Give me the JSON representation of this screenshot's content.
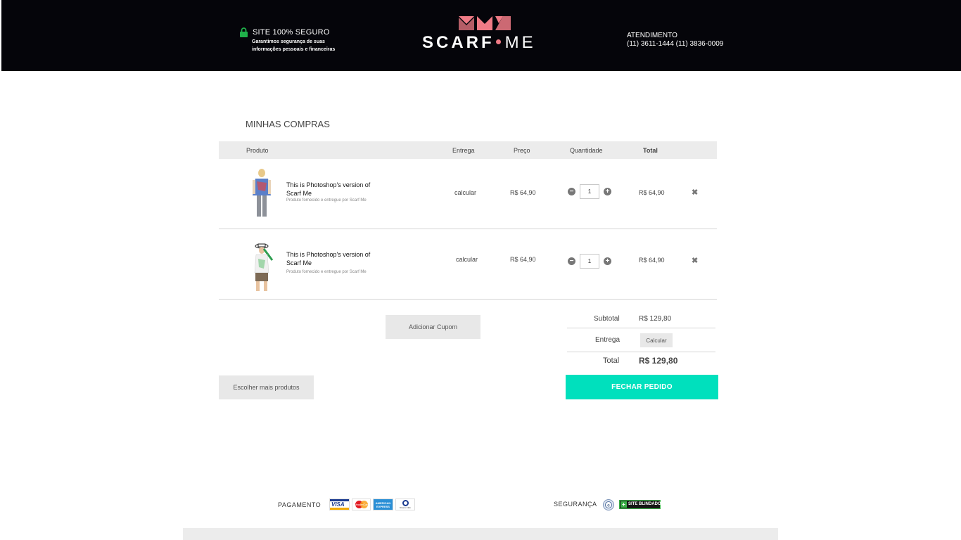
{
  "header": {
    "secure_title": "SITE 100% SEGURO",
    "secure_sub": "Garantimos segurança de suas informações pessoais e financeiras",
    "logo_left": "SCARF",
    "logo_right": "ME",
    "contact_label": "ATENDIMENTO",
    "contact_phones": "(11) 3611-1444  (11) 3836-0009"
  },
  "cart": {
    "title": "MINHAS COMPRAS",
    "columns": {
      "produto": "Produto",
      "entrega": "Entrega",
      "preco": "Preço",
      "quantidade": "Quantidade",
      "total": "Total"
    },
    "items": [
      {
        "name": "This is Photoshop's version  of Scarf Me",
        "desc": "Produto fornecido e entregue por Scarf Me",
        "entrega": "calcular",
        "preco": "R$ 64,90",
        "qty": "1",
        "total": "R$ 64,90",
        "remove": "✖"
      },
      {
        "name": "This is Photoshop's version  of Scarf Me",
        "desc": "Produto fornecido e entregue por Scarf Me",
        "entrega": "calcular",
        "preco": "R$ 64,90",
        "qty": "1",
        "total": "R$ 64,90",
        "remove": "✖"
      }
    ],
    "coupon_button": "Adicionar Cupom",
    "summary": {
      "subtotal_label": "Subtotal",
      "subtotal_value": "R$ 129,80",
      "entrega_label": "Entrega",
      "entrega_button": "Calcular",
      "total_label": "Total",
      "total_value": "R$ 129,80"
    },
    "continue_button": "Escolher mais produtos",
    "checkout_button": "FECHAR PEDIDO"
  },
  "footer": {
    "pagamento_label": "PAGAMENTO",
    "cards": [
      "VISA",
      "MasterCard",
      "AMERICAN EXPRESS",
      "Diners Club"
    ],
    "seguranca_label": "SEGURANÇA",
    "blindado_label": "SITE BLINDADO"
  },
  "colors": {
    "header_bg": "#05050a",
    "accent_green": "#00e0bd",
    "logo_pink": "#f07b86",
    "lock_green": "#1fb14a"
  },
  "icons": [
    "lock-icon",
    "minus-icon",
    "plus-icon",
    "remove-icon",
    "security-seal-icon"
  ]
}
